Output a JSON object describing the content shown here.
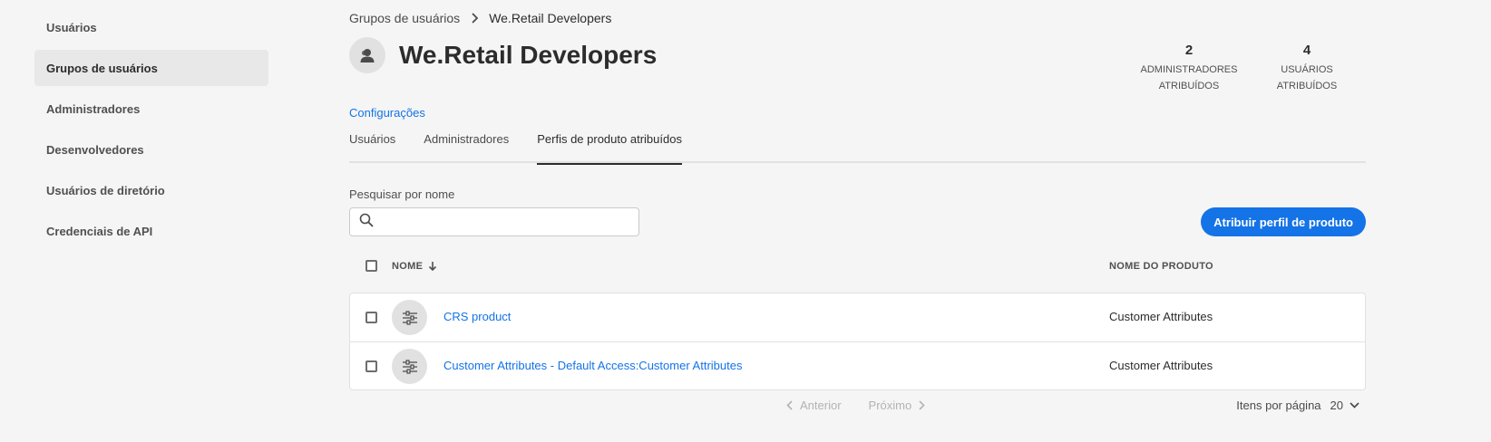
{
  "sidebar": {
    "items": [
      {
        "label": "Usuários"
      },
      {
        "label": "Grupos de usuários"
      },
      {
        "label": "Administradores"
      },
      {
        "label": "Desenvolvedores"
      },
      {
        "label": "Usuários de diretório"
      },
      {
        "label": "Credenciais de API"
      }
    ]
  },
  "breadcrumb": {
    "parent": "Grupos de usuários",
    "current": "We.Retail Developers"
  },
  "header": {
    "title": "We.Retail Developers"
  },
  "stats": [
    {
      "value": "2",
      "label_line1": "ADMINISTRADORES",
      "label_line2": "ATRIBUÍDOS"
    },
    {
      "value": "4",
      "label_line1": "USUÁRIOS",
      "label_line2": "ATRIBUÍDOS"
    }
  ],
  "settings_link": "Configurações",
  "tabs": [
    {
      "label": "Usuários"
    },
    {
      "label": "Administradores"
    },
    {
      "label": "Perfis de produto atribuídos"
    }
  ],
  "search": {
    "label": "Pesquisar por nome",
    "placeholder": ""
  },
  "assign_button": "Atribuir perfil de produto",
  "table": {
    "headers": {
      "name": "NOME",
      "product": "NOME DO PRODUTO"
    },
    "rows": [
      {
        "name": "CRS product",
        "product": "Customer Attributes"
      },
      {
        "name": "Customer Attributes - Default Access:Customer Attributes",
        "product": "Customer Attributes"
      }
    ]
  },
  "pagination": {
    "prev": "Anterior",
    "next": "Próximo",
    "per_page_label": "Itens por página",
    "per_page_value": "20"
  },
  "colors": {
    "accent": "#1473e6",
    "background": "#f5f5f5",
    "active_sidebar": "#e8e8e8"
  }
}
